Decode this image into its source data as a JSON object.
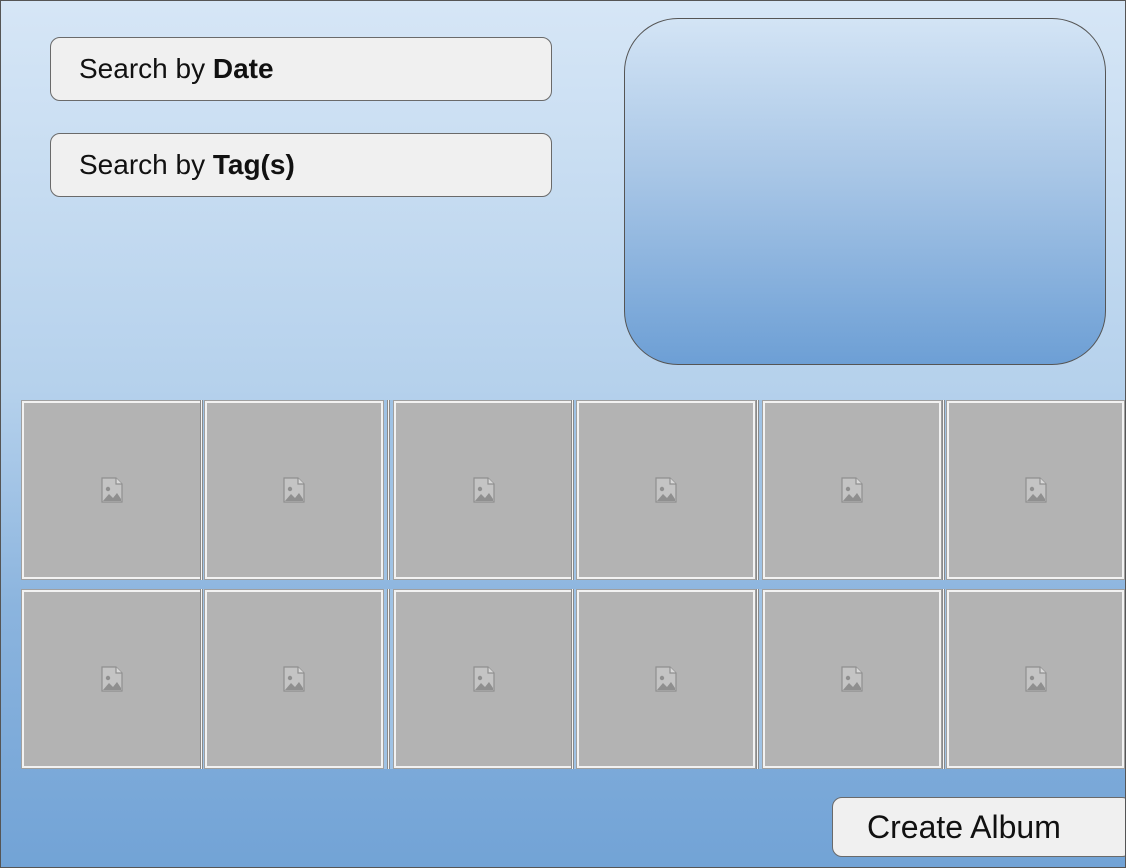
{
  "search": {
    "date_prefix": "Search by ",
    "date_keyword": "Date",
    "tags_prefix": "Search by ",
    "tags_keyword": "Tag(s)"
  },
  "photos": {
    "rows": 2,
    "columns": 6,
    "placeholder_icon": "image-placeholder-icon"
  },
  "actions": {
    "create_album_label": "Create Album"
  },
  "colors": {
    "panel_top": "#d6e6f6",
    "panel_bottom": "#72a3d6",
    "button_fill": "#f0f0f0",
    "tile_fill": "#b3b3b3"
  }
}
